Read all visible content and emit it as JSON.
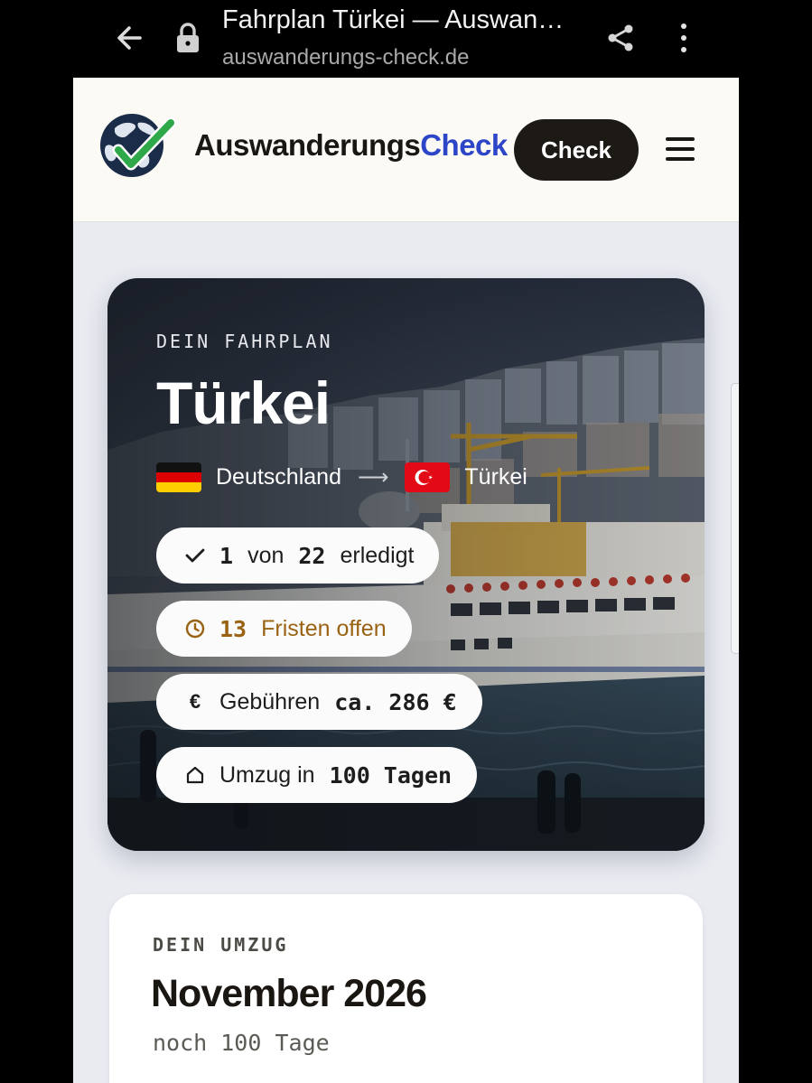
{
  "browser": {
    "tab_title": "Fahrplan Türkei — Auswan…",
    "url": "auswanderungs-check.de",
    "icons": [
      "back-arrow-icon",
      "lock-icon",
      "share-icon",
      "more-vert-icon"
    ]
  },
  "header": {
    "brand_main": "Auswanderungs",
    "brand_accent": "Check",
    "cta_label": "Check",
    "colors": {
      "accent": "#2d46c8",
      "check_green": "#2fa84a",
      "globe_navy": "#1b2c49"
    }
  },
  "hero": {
    "eyebrow": "DEIN FAHRPLAN",
    "title": "Türkei",
    "origin": "Deutschland",
    "destination": "Türkei",
    "stats": {
      "done": {
        "value": "1",
        "of_label": "von",
        "total": "22",
        "suffix": "erledigt",
        "icon": "check-icon"
      },
      "deadlines": {
        "value": "13",
        "label": "Fristen offen",
        "icon": "clock-icon",
        "color": "#9a6313"
      },
      "fees": {
        "label": "Gebühren",
        "value": "ca. 286 €",
        "icon": "euro-icon"
      },
      "move": {
        "prefix": "Umzug in",
        "value": "100 Tagen",
        "icon": "home-icon"
      }
    }
  },
  "move_card": {
    "eyebrow": "DEIN UMZUG",
    "date": "November 2026",
    "countdown": "noch 100 Tage"
  }
}
